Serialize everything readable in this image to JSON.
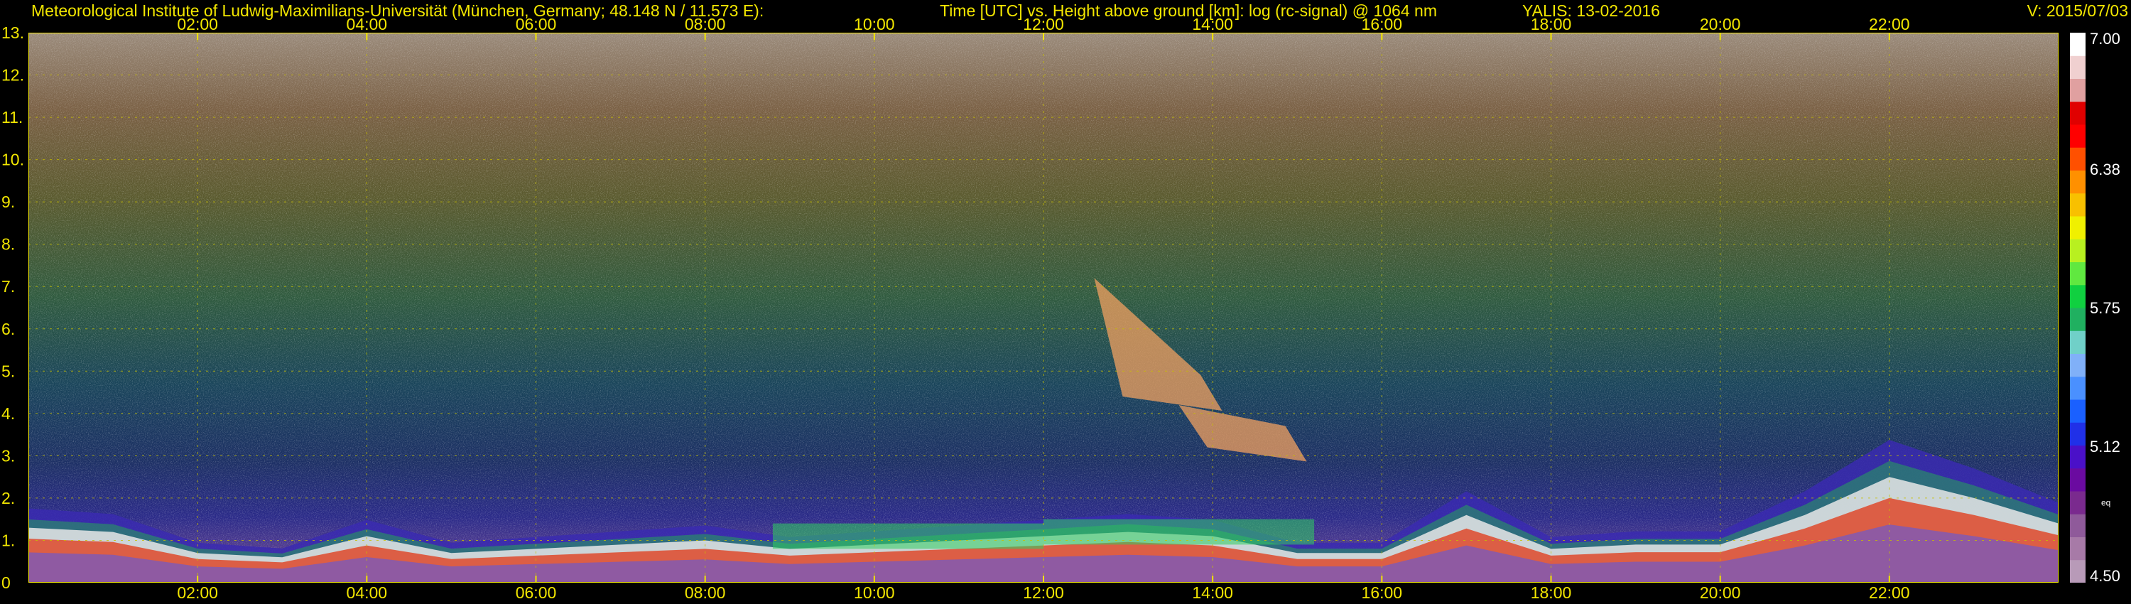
{
  "header": {
    "institute": "Meteorological Institute of Ludwig-Maximilians-Universität (München, Germany; 48.148 N / 11.573 E):",
    "axis_description": "Time [UTC] vs. Height above ground [km]: log (rc-signal) @ 1064 nm",
    "station_date": "YALIS: 13-02-2016",
    "version": "V: 2015/07/03"
  },
  "chart_data": {
    "type": "heatmap",
    "title": "Time [UTC] vs. Height above ground [km]: log (rc-signal) @ 1064 nm",
    "x_ticks": [
      "02:00",
      "04:00",
      "06:00",
      "08:00",
      "10:00",
      "12:00",
      "14:00",
      "16:00",
      "18:00",
      "20:00",
      "22:00"
    ],
    "x_tick_hours": [
      2,
      4,
      6,
      8,
      10,
      12,
      14,
      16,
      18,
      20,
      22
    ],
    "xlim_hours": [
      0,
      24
    ],
    "y_ticks": [
      "0",
      "1.",
      "2.",
      "3.",
      "4.",
      "5.",
      "6.",
      "7.",
      "8.",
      "9.",
      "10.",
      "11.",
      "12.",
      "13."
    ],
    "y_tick_values": [
      0,
      1,
      2,
      3,
      4,
      5,
      6,
      7,
      8,
      9,
      10,
      11,
      12,
      13
    ],
    "ylim_km": [
      0,
      13
    ],
    "grid": true,
    "colorbar": {
      "min": 4.5,
      "max": 7.0,
      "labels": [
        "7.00",
        "6.38",
        "5.75",
        "5.12",
        "4.50"
      ],
      "label_values": [
        7.0,
        6.38,
        5.75,
        5.12,
        4.5
      ],
      "unit": "eq",
      "colors": [
        "#b89ab8",
        "#a77aa7",
        "#8f5a9a",
        "#7a2a8e",
        "#6a0aa0",
        "#4a10c8",
        "#2030e8",
        "#1a60ff",
        "#4a90ff",
        "#80b0f8",
        "#70d0c8",
        "#20b060",
        "#10d040",
        "#60e840",
        "#b8f020",
        "#f0f000",
        "#f8c000",
        "#ff9000",
        "#ff5000",
        "#ff0000",
        "#e00000",
        "#e0a0a0",
        "#f0d0d0",
        "#ffffff"
      ]
    },
    "layers": {
      "boundary_layer_km": [
        [
          0,
          1.3
        ],
        [
          1,
          1.2
        ],
        [
          2,
          0.7
        ],
        [
          3,
          0.6
        ],
        [
          4,
          1.1
        ],
        [
          5,
          0.7
        ],
        [
          6,
          0.8
        ],
        [
          7,
          0.9
        ],
        [
          8,
          1.0
        ],
        [
          9,
          0.8
        ],
        [
          10,
          0.9
        ],
        [
          11,
          1.0
        ],
        [
          12,
          1.1
        ],
        [
          13,
          1.2
        ],
        [
          14,
          1.1
        ],
        [
          15,
          0.7
        ],
        [
          16,
          0.7
        ],
        [
          17,
          1.6
        ],
        [
          18,
          0.8
        ],
        [
          19,
          0.9
        ],
        [
          20,
          0.9
        ],
        [
          21,
          1.6
        ],
        [
          22,
          2.5
        ],
        [
          23,
          2.0
        ],
        [
          24,
          1.4
        ]
      ],
      "aerosol_band_km": [
        [
          8.8,
          1.4
        ],
        [
          12.0,
          1.5
        ]
      ],
      "cirrus_km": [
        [
          12.6,
          7.2,
          4.4
        ],
        [
          13.6,
          4.2,
          3.2
        ]
      ]
    }
  }
}
